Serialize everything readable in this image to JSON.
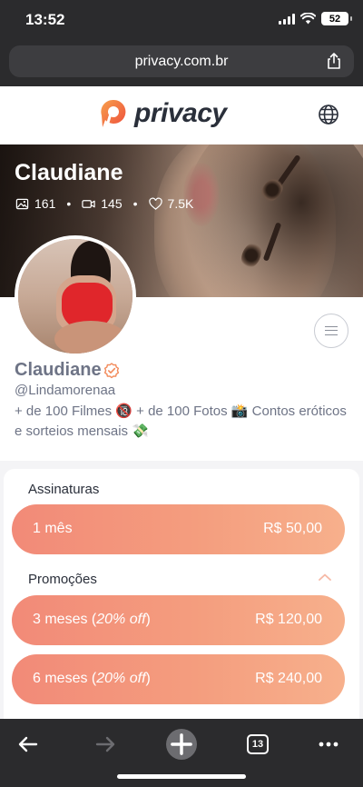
{
  "status_bar": {
    "time": "13:52",
    "battery": "52",
    "icons": [
      "signal-icon",
      "wifi-icon",
      "battery-icon"
    ]
  },
  "browser": {
    "url": "privacy.com.br",
    "icons": [
      "share-icon"
    ]
  },
  "site_header": {
    "logo_text": "privacy",
    "icons": [
      "privacy-logo-icon",
      "globe-icon"
    ]
  },
  "profile": {
    "cover_name": "Claudiane",
    "stats": {
      "photos": "161",
      "videos": "145",
      "likes": "7.5K"
    },
    "display_name": "Claudiane",
    "username": "@Lindamorenaa",
    "bio": "+ de 100 Filmes 🔞 + de 100 Fotos 📸 Contos eróticos e sorteios mensais 💸"
  },
  "subscriptions": {
    "title": "Assinaturas",
    "plans": [
      {
        "label": "1 mês",
        "price": "R$ 50,00"
      }
    ]
  },
  "promotions": {
    "title": "Promoções",
    "plans": [
      {
        "label": "3 meses",
        "discount": "20% off",
        "price": "R$ 120,00"
      },
      {
        "label": "6 meses",
        "discount": "20% off",
        "price": "R$ 240,00"
      }
    ]
  },
  "toolbar": {
    "tab_count": "13",
    "icons": [
      "back-arrow-icon",
      "forward-arrow-icon",
      "new-tab-plus-icon",
      "tabs-icon",
      "more-icon"
    ]
  },
  "colors": {
    "accent": "#f4947b",
    "brand_orange": "#f26b4a",
    "text_muted": "#6e7486",
    "chrome_dark": "#2b2b2d"
  }
}
